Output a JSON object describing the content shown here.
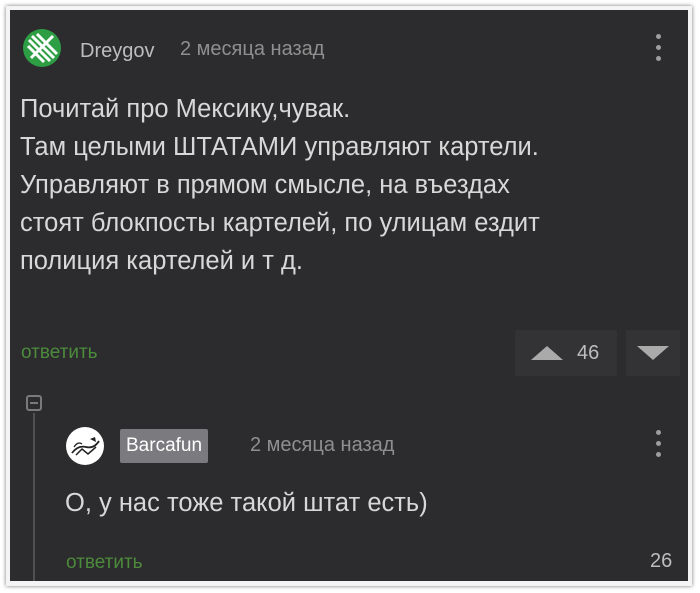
{
  "comment1": {
    "user": "Dreygov",
    "time": "2 месяца назад",
    "lines": [
      "Почитай про Мексику,чувак.",
      "Там целыми ШТАТАМИ управляют картели.",
      "Управляют в прямом смысле, на въездах",
      "стоят блокпосты картелей, по улицам ездит",
      "полиция картелей и т д."
    ],
    "reply_label": "ответить",
    "score": "46",
    "avatar_icon": "leaf-logo-icon",
    "accent": "#2e9e45"
  },
  "comment2": {
    "user": "Barcafun",
    "time": "2 месяца назад",
    "text": "О, у нас тоже такой штат есть)",
    "reply_label": "ответить",
    "score": "26",
    "avatar_icon": "drawing-avatar-icon"
  },
  "colors": {
    "background": "#2c2c2e",
    "reply_link": "#4c8a3c",
    "text": "#d8d8d8",
    "meta": "#8f8f8f"
  }
}
